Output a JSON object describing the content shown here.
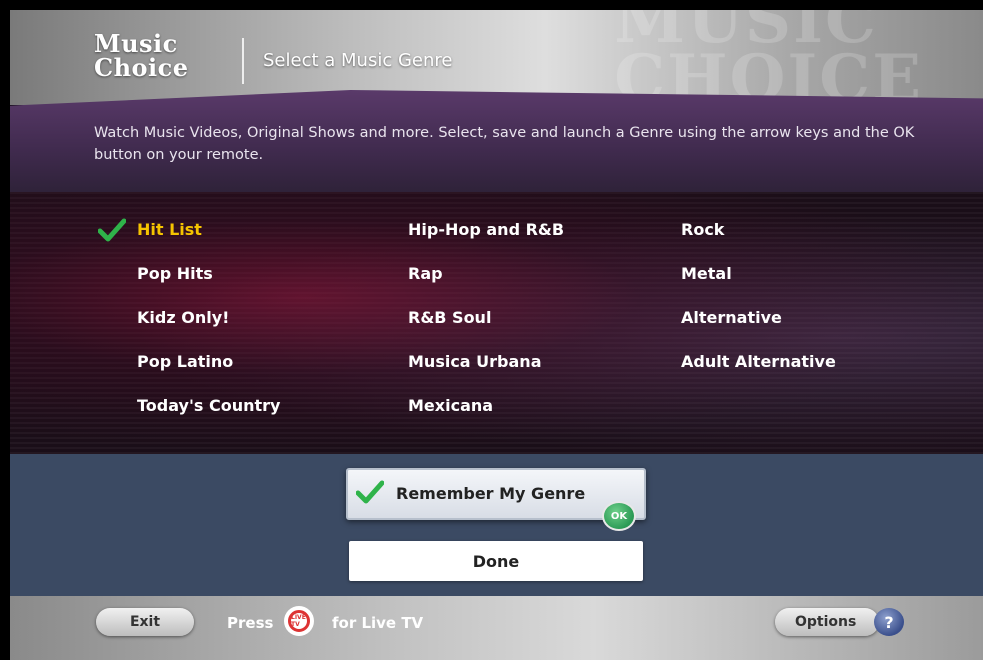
{
  "header": {
    "logo_line1": "Music",
    "logo_line2": "Choice",
    "watermark_line1": "MUSIC",
    "watermark_line2": "CHOICE",
    "title": "Select a Music Genre"
  },
  "instructions": "Watch Music Videos, Original Shows and more. Select, save and launch a Genre using the arrow keys and the OK button on your remote.",
  "genres": {
    "col1": [
      "Hit List",
      "Pop Hits",
      "Kidz Only!",
      "Pop Latino",
      "Today's Country"
    ],
    "col2": [
      "Hip-Hop and R&B",
      "Rap",
      "R&B Soul",
      "Musica Urbana",
      "Mexicana"
    ],
    "col3": [
      "Rock",
      "Metal",
      "Alternative",
      "Adult Alternative"
    ],
    "selected": "Hit List"
  },
  "remember": {
    "label": "Remember My Genre",
    "checked": true,
    "ok_badge": "OK"
  },
  "done_label": "Done",
  "footer": {
    "exit_label": "Exit",
    "press_label": "Press",
    "live_icon_text": "LIVE TV",
    "for_live_label": "for Live TV",
    "options_label": "Options",
    "help_label": "?"
  },
  "colors": {
    "selected_genre": "#f5c400",
    "check_green": "#2fb34a",
    "bottom_panel": "#3b4a63"
  }
}
